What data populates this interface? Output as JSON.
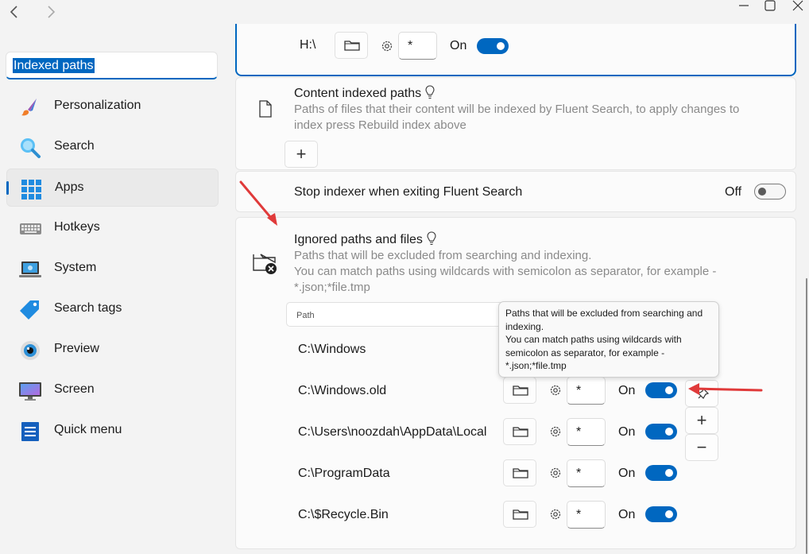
{
  "window": {
    "back_icon": "chevron-left",
    "forward_icon": "chevron-right",
    "minimize_icon": "minimize",
    "maximize_icon": "maximize",
    "close_icon": "close"
  },
  "sidebar": {
    "search_value": "Indexed paths",
    "items": [
      {
        "label": "Personalization",
        "icon": "paintbrush-icon"
      },
      {
        "label": "Search",
        "icon": "magnifier-icon"
      },
      {
        "label": "Apps",
        "icon": "apps-grid-icon",
        "active": true
      },
      {
        "label": "Hotkeys",
        "icon": "keyboard-icon"
      },
      {
        "label": "System",
        "icon": "laptop-icon"
      },
      {
        "label": "Search tags",
        "icon": "tag-icon"
      },
      {
        "label": "Preview",
        "icon": "eye-icon"
      },
      {
        "label": "Screen",
        "icon": "monitor-icon"
      },
      {
        "label": "Quick menu",
        "icon": "menu-list-icon"
      }
    ]
  },
  "top_row": {
    "path": "H:\\",
    "filter": "*",
    "state": "On"
  },
  "content_indexed": {
    "title": "Content indexed paths",
    "description": "Paths of files that their content will be indexed by Fluent Search, to apply changes to index press Rebuild index above",
    "add_label": "+"
  },
  "stop_indexer": {
    "label": "Stop indexer when exiting Fluent Search",
    "state": "Off"
  },
  "ignored": {
    "title": "Ignored paths and files",
    "description_line1": "Paths that will be excluded from searching and indexing.",
    "description_line2": "You can match paths using wildcards with semicolon as separator, for example -",
    "description_line3": "*.json;*file.tmp",
    "path_placeholder": "Path",
    "tooltip": "Paths that will be excluded from searching and indexing.\nYou can match paths using wildcards with semicolon as separator, for example - *.json;*file.tmp",
    "rows": [
      {
        "path": "C:\\Windows"
      },
      {
        "path": "C:\\Windows.old",
        "filter": "*",
        "state": "On"
      },
      {
        "path": "C:\\Users\\noozdah\\AppData\\Local",
        "filter": "*",
        "state": "On"
      },
      {
        "path": "C:\\ProgramData",
        "filter": "*",
        "state": "On"
      },
      {
        "path": "C:\\$Recycle.Bin",
        "filter": "*",
        "state": "On"
      }
    ],
    "add_label": "+",
    "remove_label": "−"
  },
  "colors": {
    "accent": "#0067c0",
    "annotation": "#e03a3a"
  }
}
